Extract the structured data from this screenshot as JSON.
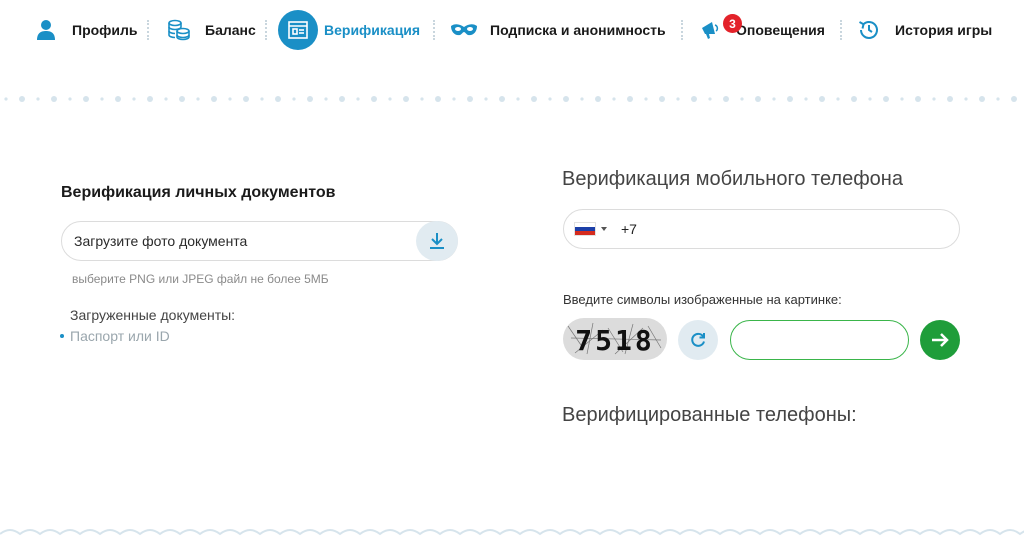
{
  "nav": {
    "items": [
      {
        "label": "Профиль",
        "icon": "user-icon"
      },
      {
        "label": "Баланс",
        "icon": "coins-icon"
      },
      {
        "label": "Верификация",
        "icon": "document-icon",
        "active": true
      },
      {
        "label": "Подписка и анонимность",
        "icon": "mask-icon"
      },
      {
        "label": "Оповещения",
        "icon": "megaphone-icon",
        "badge": "3"
      },
      {
        "label": "История игры",
        "icon": "history-icon"
      }
    ]
  },
  "documents": {
    "title": "Верификация личных документов",
    "upload_placeholder": "Загрузите фото документа",
    "hint": "выберите PNG или JPEG файл не более 5МБ",
    "uploaded_title": "Загруженные документы:",
    "uploaded_items": [
      "Паспорт или ID"
    ]
  },
  "phone": {
    "title": "Верификация мобильного телефона",
    "country_code": "+7",
    "flag_colors": [
      "#ffffff",
      "#1c3fa8",
      "#d52b1e"
    ],
    "captcha_label": "Введите символы изображенные на картинке:",
    "captcha_value": "",
    "captcha_text": "7518",
    "verified_title": "Верифицированные телефоны:"
  },
  "colors": {
    "accent": "#1a8fc6",
    "success": "#1f9d3a",
    "badge": "#e3222a"
  }
}
